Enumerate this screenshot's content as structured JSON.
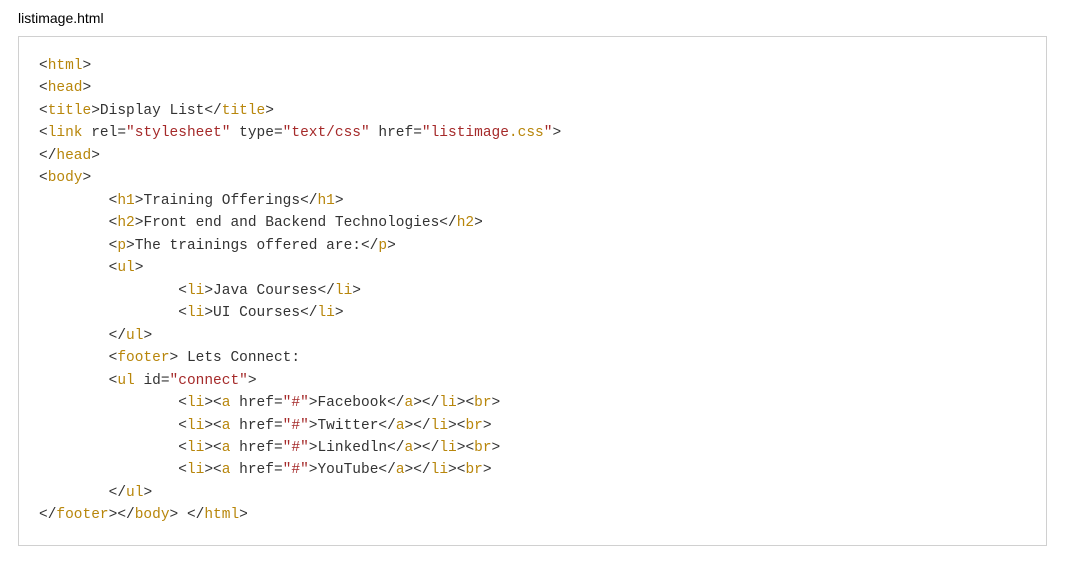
{
  "filename": "listimage.html",
  "code": {
    "html_tag": "html",
    "head_tag": "head",
    "title_tag": "title",
    "title_text": "Display List",
    "link_tag": "link",
    "rel_attr": "rel",
    "rel_val": "\"stylesheet\"",
    "type_attr": "type",
    "type_val": "\"text/css\"",
    "href_attr": "href",
    "href_val1": "\"listimage",
    "href_ext": ".css",
    "href_close": "\"",
    "body_tag": "body",
    "h1_tag": "h1",
    "h1_text": "Training Offerings",
    "h2_tag": "h2",
    "h2_text": "Front end and Backend Technologies",
    "p_tag": "p",
    "p_text": "The trainings offered are:",
    "ul_tag": "ul",
    "li_tag": "li",
    "li1_text": "Java Courses",
    "li2_text": "UI Courses",
    "footer_tag": "footer",
    "footer_text": " Lets Connect:",
    "id_attr": "id",
    "id_val": "\"connect\"",
    "a_tag": "a",
    "href_hash": "\"#\"",
    "link1_text": "Facebook",
    "link2_text": "Twitter",
    "link3_text": "Linkedln",
    "link4_text": "YouTube",
    "br_tag": "br"
  }
}
